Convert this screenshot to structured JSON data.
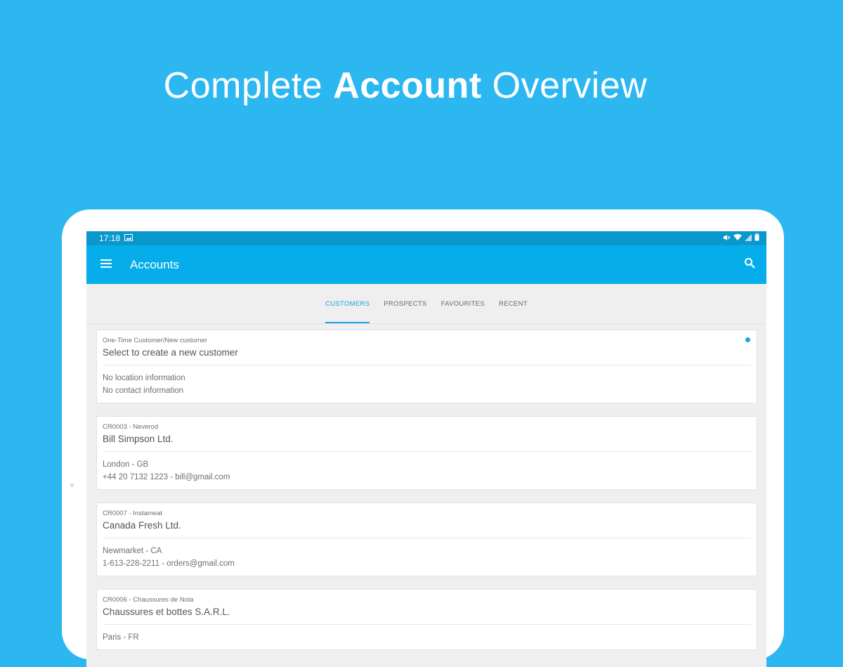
{
  "headline": {
    "prefix": "Complete ",
    "bold": "Account",
    "suffix": " Overview"
  },
  "statusbar": {
    "time": "17:18"
  },
  "appbar": {
    "title": "Accounts"
  },
  "tabs": [
    {
      "label": "CUSTOMERS",
      "active": true
    },
    {
      "label": "PROSPECTS",
      "active": false
    },
    {
      "label": "FAVOURITES",
      "active": false
    },
    {
      "label": "RECENT",
      "active": false
    }
  ],
  "accounts": [
    {
      "code": "One-Time Customer/New customer",
      "name": "Select to create a new customer",
      "location": "No location information",
      "contact": "No contact information"
    },
    {
      "code": "CR0003 - Neverod",
      "name": "Bill Simpson Ltd.",
      "location": "London - GB",
      "contact": "+44 20 7132 1223 - bill@gmail.com"
    },
    {
      "code": "CR0007 - Instameat",
      "name": "Canada Fresh Ltd.",
      "location": "Newmarket - CA",
      "contact": "1-613-228-2211 - orders@gmail.com"
    },
    {
      "code": "CR0006 - Chaussures de Nola",
      "name": "Chaussures et bottes S.A.R.L.",
      "location": "Paris - FR",
      "contact": ""
    }
  ],
  "colors": {
    "background": "#2cb7f0",
    "statusbar": "#0a97cc",
    "appbar": "#05aeea",
    "accent": "#1aa3de"
  },
  "icons": {
    "menu": "hamburger-menu-icon",
    "search": "search-icon",
    "image": "image-icon",
    "wifi": "wifi-icon",
    "signal": "signal-icon",
    "battery": "battery-icon",
    "mute": "mute-icon",
    "selection-dot": "selected-dot-icon"
  }
}
